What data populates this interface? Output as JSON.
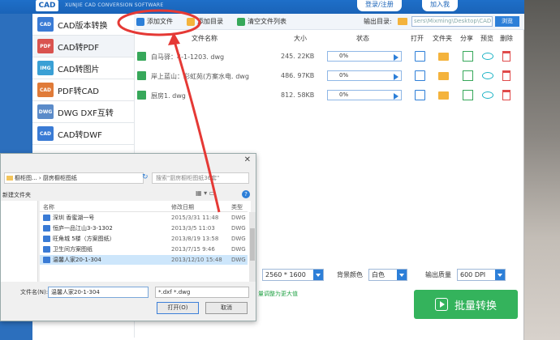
{
  "app": {
    "logo": "CAD",
    "subtitle": "XUNJIE CAD CONVERSION SOFTWARE",
    "login_label": "登录/注册",
    "join_label": "加入我"
  },
  "toolbar": {
    "add_file": "添加文件",
    "add_dir": "添加目录",
    "clear_list": "清空文件列表",
    "out_dir_label": "输出目录:",
    "out_dir_value": "sers\\Mixming\\Desktop\\CAD",
    "browse": "浏览"
  },
  "menu": [
    {
      "label": "CAD版本转换",
      "icon": "CAD"
    },
    {
      "label": "CAD转PDF",
      "icon": "PDF"
    },
    {
      "label": "CAD转图片",
      "icon": "IMG"
    },
    {
      "label": "PDF转CAD",
      "icon": "CAD"
    },
    {
      "label": "DWG DXF互转",
      "icon": "DWG"
    },
    {
      "label": "CAD转DWF",
      "icon": "CAD"
    }
  ],
  "table": {
    "headers": {
      "name": "文件名称",
      "size": "大小",
      "status": "状态",
      "open": "打开",
      "folder": "文件夹",
      "share": "分享",
      "preview": "预览",
      "delete": "删除"
    },
    "rows": [
      {
        "name": "白马驿：4-1-1203. dwg",
        "size": "245. 22KB",
        "progress": "0%"
      },
      {
        "name": "岸上蓝山：彩虹苑(方案水电. dwg",
        "size": "486. 97KB",
        "progress": "0%"
      },
      {
        "name": "厨房1. dwg",
        "size": "812. 58KB",
        "progress": "0%"
      }
    ]
  },
  "settings": {
    "resolution": "2560 * 1600",
    "bg_color_label": "背景颜色",
    "bg_color_value": "白色",
    "quality_label": "输出质量",
    "quality_value": "600 DPI",
    "hint": "量调整为更大值",
    "convert_label": "批量转换"
  },
  "dialog": {
    "path": "橱柜图... › 厨房橱柜图纸",
    "search_placeholder": "搜索\"厨房橱柜图纸36套\"",
    "new_folder": "新建文件夹",
    "headers": {
      "name": "名称",
      "date": "修改日期",
      "type": "类型"
    },
    "files": [
      {
        "name": "深圳 香蜜湖一号",
        "date": "2015/3/31 11:48",
        "type": "DWG"
      },
      {
        "name": "恒庐一品江山3-3-1302",
        "date": "2013/3/5 11:03",
        "type": "DWG"
      },
      {
        "name": "旺角城 5楼（方案图纸）",
        "date": "2013/8/19 13:58",
        "type": "DWG"
      },
      {
        "name": "卫生间方案图纸",
        "date": "2013/7/15 9:46",
        "type": "DWG"
      },
      {
        "name": "温馨人家20-1-304",
        "date": "2013/12/10 15:48",
        "type": "DWG"
      }
    ],
    "filename_label": "文件名(N):",
    "filename_value": "温馨人家20-1-304",
    "filetype_value": "*.dxf *.dwg",
    "open_btn": "打开(O)",
    "cancel_btn": "取消"
  },
  "colors": {
    "brand_blue": "#1e6fc9",
    "convert_green": "#34b35c",
    "annotation_red": "#e53935"
  }
}
